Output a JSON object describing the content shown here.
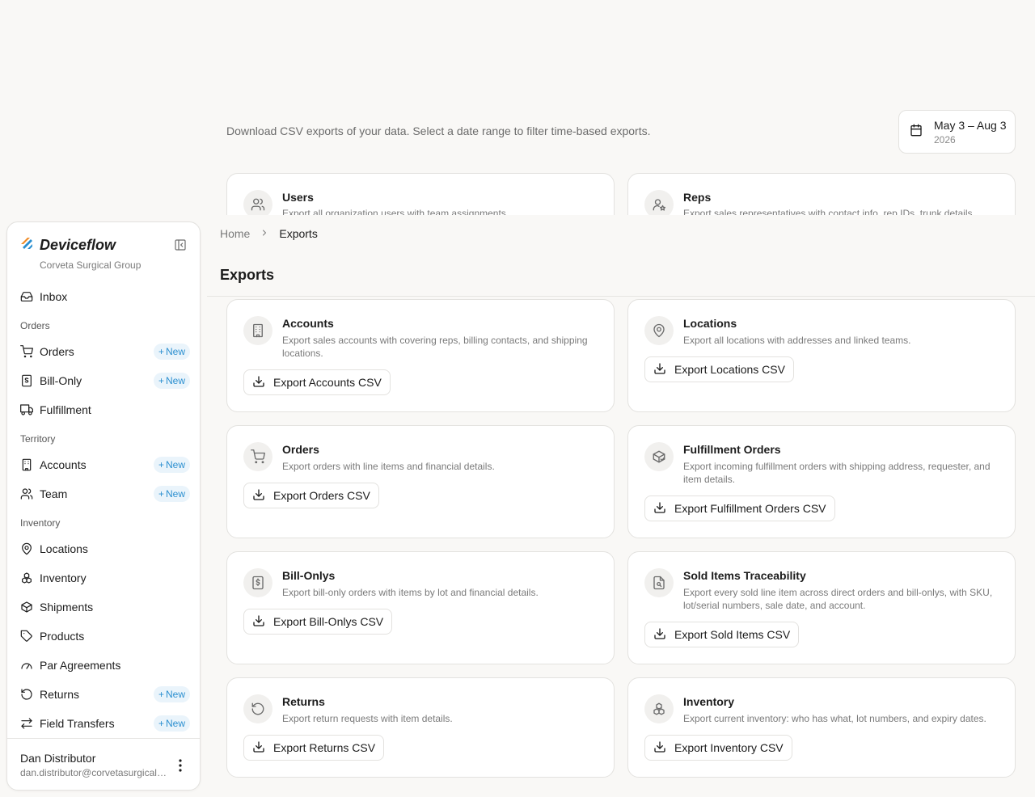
{
  "top": {
    "description": "Download CSV exports of your data. Select a date range to filter time-based exports.",
    "date_range": {
      "label": "May 3 – Aug 3",
      "year": "2026"
    },
    "clipped_cards": [
      {
        "title": "Users",
        "description": "Export all organization users with team assignments.",
        "icon": "users-icon"
      },
      {
        "title": "Reps",
        "description": "Export sales representatives with contact info, rep IDs, trunk details",
        "icon": "rep-badge-icon"
      }
    ]
  },
  "header": {
    "breadcrumb": {
      "home": "Home",
      "current": "Exports"
    },
    "title": "Exports"
  },
  "cards": [
    {
      "title": "Accounts",
      "description": "Export sales accounts with covering reps, billing contacts, and shipping locations.",
      "button": "Export Accounts CSV",
      "icon": "building-icon"
    },
    {
      "title": "Locations",
      "description": "Export all locations with addresses and linked teams.",
      "button": "Export Locations CSV",
      "icon": "map-pin-icon"
    },
    {
      "title": "Orders",
      "description": "Export orders with line items and financial details.",
      "button": "Export Orders CSV",
      "icon": "cart-icon"
    },
    {
      "title": "Fulfillment Orders",
      "description": "Export incoming fulfillment orders with shipping address, requester, and item details.",
      "button": "Export Fulfillment Orders CSV",
      "icon": "package-check-icon"
    },
    {
      "title": "Bill-Onlys",
      "description": "Export bill-only orders with items by lot and financial details.",
      "button": "Export Bill-Onlys CSV",
      "icon": "receipt-dollar-icon"
    },
    {
      "title": "Sold Items Traceability",
      "description": "Export every sold line item across direct orders and bill-onlys, with SKU, lot/serial numbers, sale date, and account.",
      "button": "Export Sold Items CSV",
      "icon": "file-search-icon"
    },
    {
      "title": "Returns",
      "description": "Export return requests with item details.",
      "button": "Export Returns CSV",
      "icon": "return-icon"
    },
    {
      "title": "Inventory",
      "description": "Export current inventory: who has what, lot numbers, and expiry dates.",
      "button": "Export Inventory CSV",
      "icon": "boxes-icon"
    }
  ],
  "sidebar": {
    "brand": "Deviceflow",
    "org": "Corveta Surgical Group",
    "inbox": "Inbox",
    "new_label": "New",
    "sections": {
      "orders": "Orders",
      "territory": "Territory",
      "inventory": "Inventory"
    },
    "items": {
      "orders": "Orders",
      "bill_only": "Bill-Only",
      "fulfillment": "Fulfillment",
      "accounts": "Accounts",
      "team": "Team",
      "locations": "Locations",
      "inventory": "Inventory",
      "shipments": "Shipments",
      "products": "Products",
      "par_agreements": "Par Agreements",
      "returns": "Returns",
      "field_transfers": "Field Transfers"
    },
    "user": {
      "name": "Dan Distributor",
      "email": "dan.distributor@corvetasurgicalgroup.com"
    }
  },
  "colors": {
    "background": "#f9f8f6",
    "card": "#ffffff",
    "border": "#e3e2df",
    "new_badge_bg": "#eaf4fb",
    "new_badge_text": "#2b8fd0",
    "brand_orange": "#f08a24",
    "brand_blue": "#2b8fd0"
  }
}
